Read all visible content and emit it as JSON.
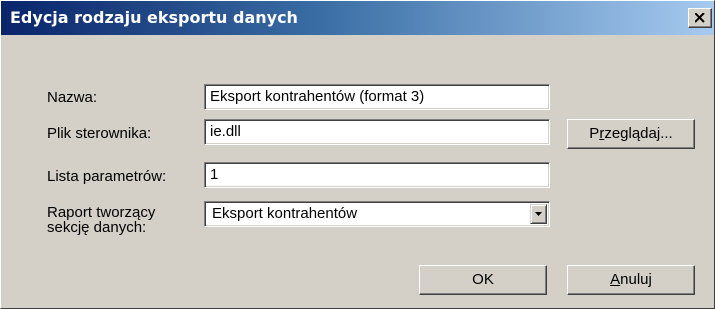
{
  "window": {
    "title": "Edycja rodzaju eksportu danych"
  },
  "form": {
    "name_label": "Nazwa:",
    "name_value": "Eksport kontrahentów (format 3)",
    "driver_label": "Plik sterownika:",
    "driver_value": "ie.dll",
    "params_label": "Lista parametrów:",
    "params_value": "1",
    "report_label_line1": "Raport tworzący",
    "report_label_line2": "sekcję danych:",
    "report_value": "Eksport kontrahentów"
  },
  "buttons": {
    "browse_prefix": "P",
    "browse_mnemonic": "r",
    "browse_rest": "zeglądaj...",
    "ok_label": "OK",
    "cancel_mnemonic": "A",
    "cancel_rest": "nuluj"
  },
  "icons": {
    "close": "close-icon",
    "dropdown": "chevron-down-icon"
  },
  "colors": {
    "face": "#d4d0c8",
    "title_start": "#0a246a",
    "title_end": "#a6caf0",
    "title_text": "#ffffff"
  }
}
